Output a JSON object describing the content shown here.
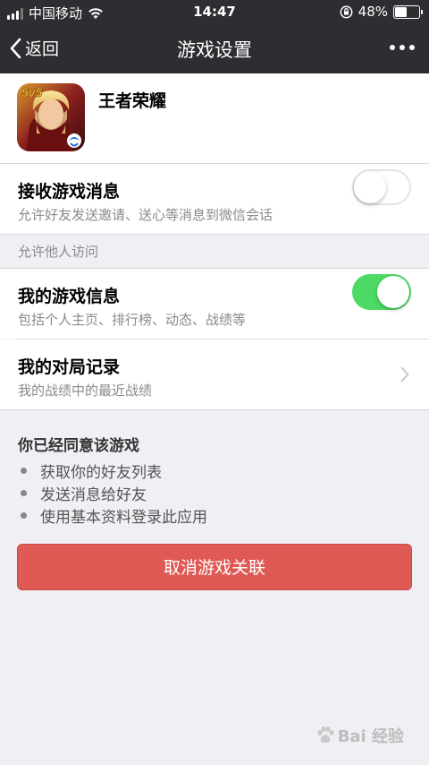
{
  "status_bar": {
    "carrier": "中国移动",
    "time": "14:47",
    "battery_percent": "48%",
    "battery_level": 0.48
  },
  "nav": {
    "back_label": "返回",
    "title": "游戏设置",
    "more_icon": "more-dots-icon"
  },
  "game": {
    "name": "王者荣耀",
    "icon_badge": "5v5"
  },
  "settings": {
    "receive_messages": {
      "title": "接收游戏消息",
      "subtitle": "允许好友发送邀请、送心等消息到微信会话",
      "enabled": false
    },
    "section_label": "允许他人访问",
    "my_game_info": {
      "title": "我的游戏信息",
      "subtitle": "包括个人主页、排行榜、动态、战绩等",
      "enabled": true
    },
    "match_records": {
      "title": "我的对局记录",
      "subtitle": "我的战绩中的最近战绩"
    }
  },
  "consent": {
    "title": "你已经同意该游戏",
    "permissions": [
      "获取你的好友列表",
      "发送消息给好友",
      "使用基本资料登录此应用"
    ]
  },
  "unlink_button": "取消游戏关联",
  "watermark": "Bai 经验",
  "colors": {
    "header_bg": "#2e2e32",
    "page_bg": "#efeff4",
    "toggle_on": "#4cd964",
    "danger": "#e05a55"
  }
}
